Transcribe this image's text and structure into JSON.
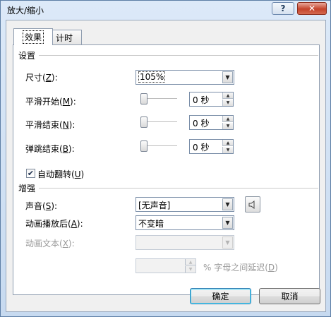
{
  "window": {
    "title": "放大/缩小",
    "help_label": "?",
    "close_label": "✕"
  },
  "tabs": [
    {
      "label": "效果",
      "active": true
    },
    {
      "label": "计时",
      "active": false
    }
  ],
  "settings": {
    "group_label": "设置",
    "size": {
      "label_pre": "尺寸(",
      "key": "Z",
      "label_post": "):",
      "value": "105%"
    },
    "smooth_start": {
      "label_pre": "平滑开始(",
      "key": "M",
      "label_post": "):",
      "value": "0 秒",
      "level": 0
    },
    "smooth_end": {
      "label_pre": "平滑结束(",
      "key": "N",
      "label_post": "):",
      "value": "0 秒",
      "level": 0
    },
    "bounce_end": {
      "label_pre": "弹跳结束(",
      "key": "B",
      "label_post": "):",
      "value": "0 秒",
      "level": 0
    },
    "auto_reverse": {
      "label_pre": "自动翻转(",
      "key": "U",
      "label_post": ")",
      "checked": true
    }
  },
  "enhancements": {
    "group_label": "增强",
    "sound": {
      "label_pre": "声音(",
      "key": "S",
      "label_post": "):",
      "value": "[无声音]",
      "button_icon": "speaker-icon"
    },
    "after_animation": {
      "label_pre": "动画播放后(",
      "key": "A",
      "label_post": "):",
      "value": "不变暗"
    },
    "animate_text": {
      "label_pre": "动画文本(",
      "key": "X",
      "label_post": "):",
      "value": "",
      "disabled": true
    },
    "letter_delay": {
      "value": "",
      "suffix_pre": "% 字母之间延迟(",
      "key": "D",
      "suffix_post": ")",
      "disabled": true
    }
  },
  "buttons": {
    "ok": "确定",
    "cancel": "取消"
  },
  "icons": {
    "dropdown": "chevron-down-icon",
    "spin_up": "spin-up-icon",
    "spin_down": "spin-down-icon",
    "check": "checkmark-icon"
  },
  "colors": {
    "title_bar": "#dce9f8",
    "close_button": "#c4432b",
    "default_button_border": "#3c7fb1"
  }
}
